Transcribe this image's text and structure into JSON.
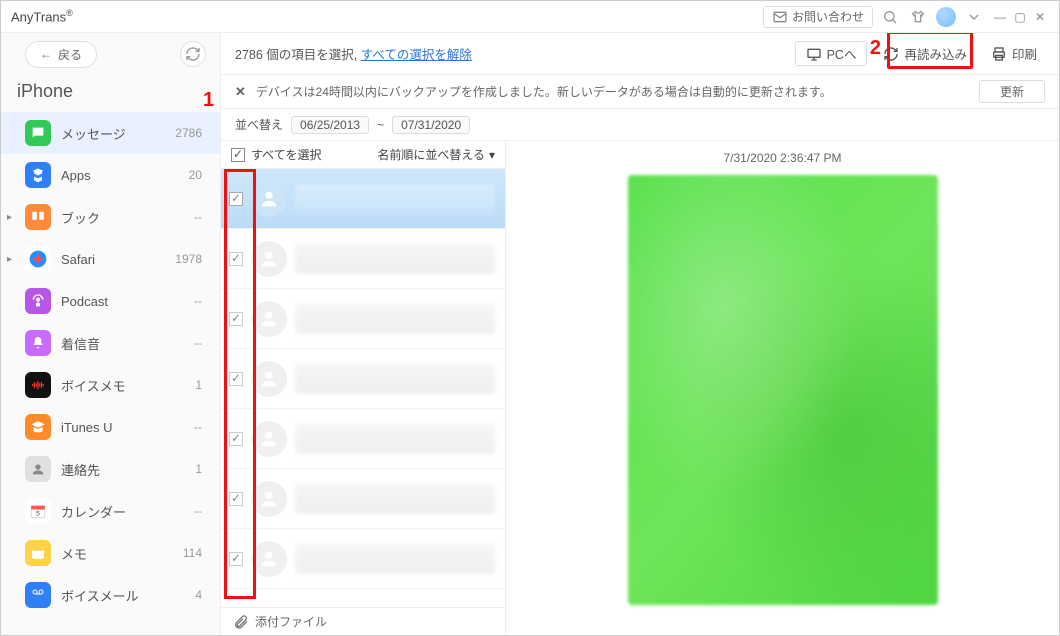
{
  "app": {
    "name": "AnyTrans",
    "sup": "®"
  },
  "titlebar": {
    "contact": "お問い合わせ"
  },
  "sidebar": {
    "back": "戻る",
    "device": "iPhone",
    "items": [
      {
        "label": "メッセージ",
        "count": "2786",
        "color": "#34c759",
        "icon": "message",
        "active": true
      },
      {
        "label": "Apps",
        "count": "20",
        "color": "#2f7ff6",
        "icon": "apps"
      },
      {
        "label": "ブック",
        "count": "--",
        "color": "#ff8a3c",
        "icon": "book",
        "caret": true
      },
      {
        "label": "Safari",
        "count": "1978",
        "color": "#fff",
        "icon": "safari",
        "caret": true
      },
      {
        "label": "Podcast",
        "count": "--",
        "color": "#b857e6",
        "icon": "podcast"
      },
      {
        "label": "着信音",
        "count": "--",
        "color": "#c86bff",
        "icon": "bell"
      },
      {
        "label": "ボイスメモ",
        "count": "1",
        "color": "#111",
        "icon": "voicememo"
      },
      {
        "label": "iTunes U",
        "count": "--",
        "color": "#ff8a2a",
        "icon": "itunesu"
      },
      {
        "label": "連絡先",
        "count": "1",
        "color": "#e0e0e0",
        "icon": "contacts"
      },
      {
        "label": "カレンダー",
        "count": "--",
        "color": "#fff",
        "icon": "calendar"
      },
      {
        "label": "メモ",
        "count": "114",
        "color": "#ffd24a",
        "icon": "notes"
      },
      {
        "label": "ボイスメール",
        "count": "4",
        "color": "#2f7ff6",
        "icon": "voicemail"
      }
    ]
  },
  "toolbar": {
    "selected_text_prefix": "2786 個の項目を選択,",
    "deselect_link": "すべての選択を解除",
    "to_pc": "PCへ",
    "reload": "再読み込み",
    "print": "印刷"
  },
  "notice": {
    "text": "デバイスは24時間以内にバックアップを作成しました。新しいデータがある場合は自動的に更新されます。",
    "update": "更新"
  },
  "sort": {
    "label": "並べ替え",
    "date_from": "06/25/2013",
    "date_to": "07/31/2020",
    "tilde": "~"
  },
  "list_header": {
    "select_all": "すべてを選択",
    "sort_by_name": "名前順に並べ替える"
  },
  "attach": "添付ファイル",
  "preview": {
    "timestamp": "7/31/2020 2:36:47 PM"
  },
  "callouts": {
    "one": "1",
    "two": "2"
  }
}
